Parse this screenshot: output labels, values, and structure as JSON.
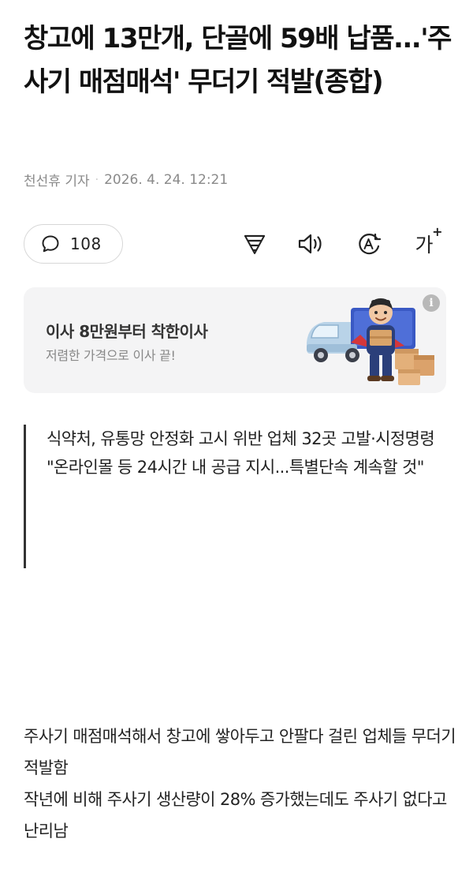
{
  "article": {
    "title": "창고에 13만개, 단골에 59배 납품...'주사기 매점매석' 무더기 적발(종합)",
    "reporter": "천선휴 기자",
    "datetime": "2026. 4. 24. 12:21"
  },
  "toolbar": {
    "comment_count": "108",
    "icons": [
      "comment-icon",
      "summary-filter-icon",
      "speaker-icon",
      "translate-icon",
      "font-size-icon"
    ],
    "font_size_label": "가",
    "font_size_plus": "+"
  },
  "ad": {
    "title": "이사 8만원부터 착한이사",
    "subtitle": "저렴한 가격으로 이사 끝!",
    "info_label": "i"
  },
  "summary": {
    "lines": [
      "식약처, 유통망 안정화 고시 위반 업체 32곳 고발·시정명령",
      "\"온라인몰 등 24시간 내 공급 지시...특별단속 계속할 것\""
    ]
  },
  "body": {
    "paragraphs": [
      "주사기 매점매석해서 창고에 쌓아두고 안팔다 걸린 업체들 무더기 적발함",
      "작년에 비해 주사기 생산량이 28% 증가했는데도 주사기 없다고 난리남"
    ]
  },
  "colors": {
    "text": "#111111",
    "meta": "#8a8a8a",
    "ad_bg": "#f4f4f5",
    "quote_bar": "#333333"
  }
}
